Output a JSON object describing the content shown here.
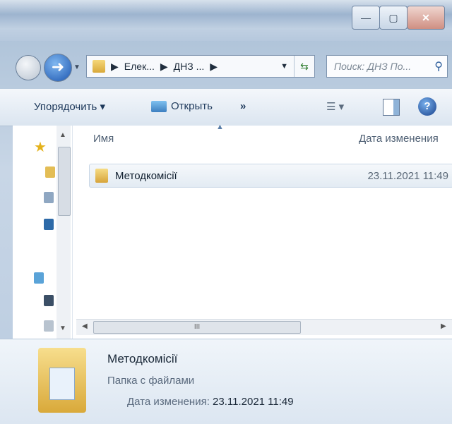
{
  "window": {
    "caption_buttons": [
      "minimize-icon",
      "maximize-icon",
      "close-icon"
    ]
  },
  "address": {
    "segments": [
      "Елек...",
      "ДНЗ ..."
    ],
    "search_placeholder": "Поиск: ДНЗ По..."
  },
  "toolbar": {
    "organize_label": "Упорядочить",
    "open_label": "Открыть",
    "more_label": "»"
  },
  "file_list": {
    "col_name": "Имя",
    "col_date": "Дата изменения",
    "rows": [
      {
        "name": "Методкомісії",
        "date": "23.11.2021 11:49"
      }
    ],
    "hscroll_grip": "III"
  },
  "details": {
    "name": "Методкомісії",
    "type": "Папка с файлами",
    "date_label": "Дата изменения:",
    "date_value": "23.11.2021 11:49"
  }
}
